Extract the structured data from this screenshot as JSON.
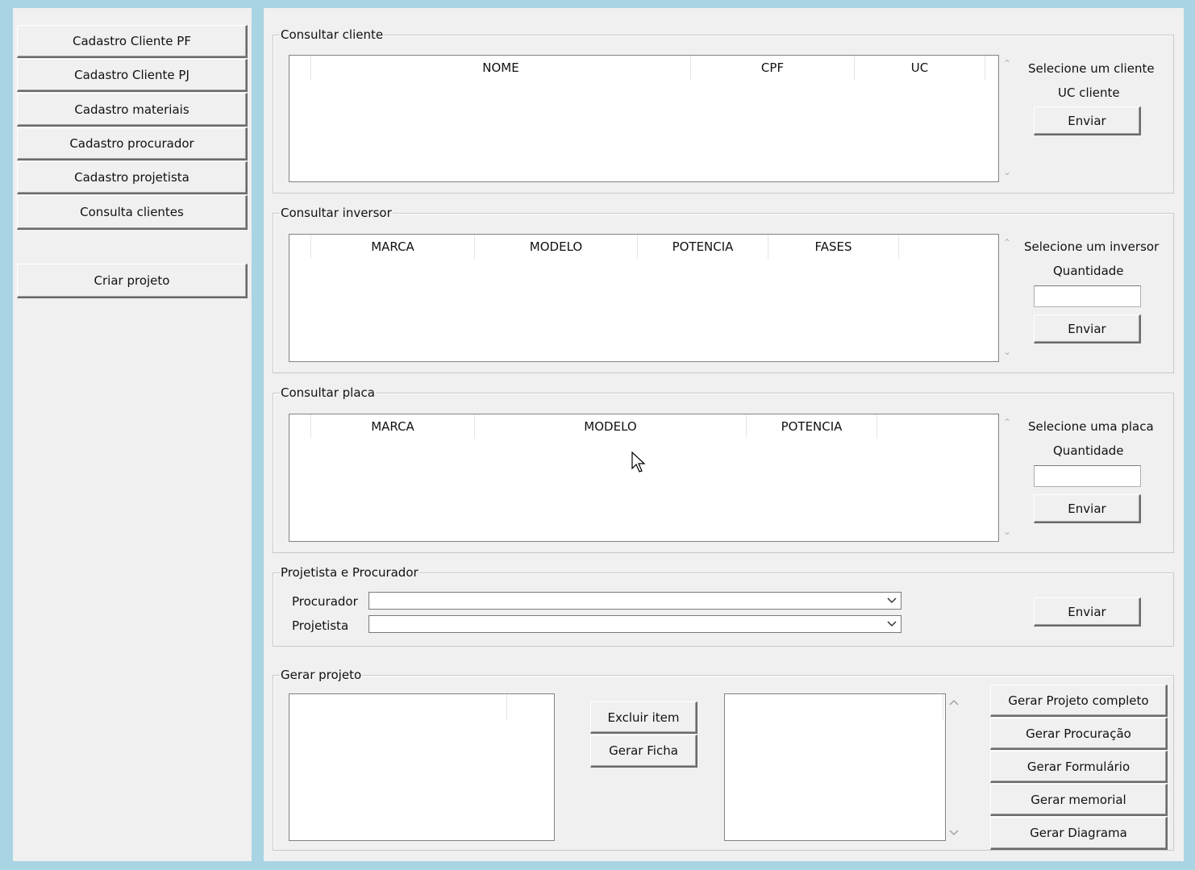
{
  "sidebar": {
    "buttons": [
      "Cadastro Cliente PF",
      "Cadastro Cliente PJ",
      "Cadastro materiais",
      "Cadastro procurador",
      "Cadastro projetista",
      "Consulta clientes"
    ],
    "create_project": "Criar projeto"
  },
  "cliente": {
    "title": "Consultar cliente",
    "columns": [
      "NOME",
      "CPF",
      "UC"
    ],
    "select_label": "Selecione um cliente",
    "uc_label": "UC cliente",
    "send": "Enviar"
  },
  "inversor": {
    "title": "Consultar inversor",
    "columns": [
      "MARCA",
      "MODELO",
      "POTENCIA",
      "FASES"
    ],
    "select_label": "Selecione um inversor",
    "qty_label": "Quantidade",
    "qty_value": "",
    "send": "Enviar"
  },
  "placa": {
    "title": "Consultar placa",
    "columns": [
      "MARCA",
      "MODELO",
      "POTENCIA"
    ],
    "select_label": "Selecione uma placa",
    "qty_label": "Quantidade",
    "qty_value": "",
    "send": "Enviar"
  },
  "proj_proc": {
    "title": "Projetista e Procurador",
    "procurador_label": "Procurador",
    "procurador_value": "",
    "projetista_label": "Projetista",
    "projetista_value": "",
    "send": "Enviar"
  },
  "gerar": {
    "title": "Gerar projeto",
    "excluir": "Excluir item",
    "ficha": "Gerar Ficha",
    "actions": [
      "Gerar Projeto completo",
      "Gerar Procuração",
      "Gerar Formulário",
      "Gerar memorial",
      "Gerar Diagrama"
    ]
  }
}
